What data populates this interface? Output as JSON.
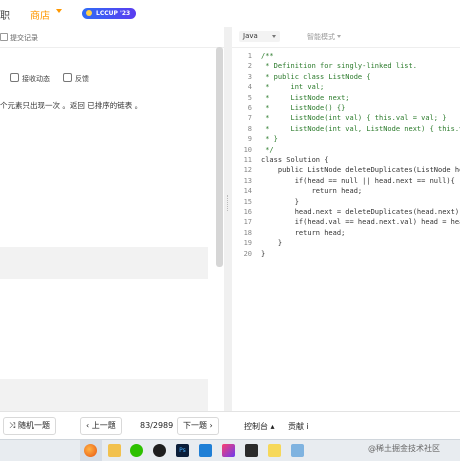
{
  "header": {
    "nav_job": "职",
    "nav_shop": "商店",
    "badge": "LCCUP '23"
  },
  "left": {
    "tab_submissions": "提交记录",
    "actions": {
      "receive": "接收动态",
      "feedback": "反馈"
    },
    "problem_text": "个元素只出现一次 。返回 已排序的链表 。"
  },
  "editor": {
    "language": "Java",
    "mode": "智能模式",
    "lines": [
      {
        "n": "1",
        "t": "/**",
        "c": true
      },
      {
        "n": "2",
        "t": " * Definition for singly-linked list.",
        "c": true
      },
      {
        "n": "3",
        "t": " * public class ListNode {",
        "c": true
      },
      {
        "n": "4",
        "t": " *     int val;",
        "c": true
      },
      {
        "n": "5",
        "t": " *     ListNode next;",
        "c": true
      },
      {
        "n": "6",
        "t": " *     ListNode() {}",
        "c": true
      },
      {
        "n": "7",
        "t": " *     ListNode(int val) { this.val = val; }",
        "c": true
      },
      {
        "n": "8",
        "t": " *     ListNode(int val, ListNode next) { this.val",
        "c": true
      },
      {
        "n": "9",
        "t": " * }",
        "c": true
      },
      {
        "n": "10",
        "t": " */",
        "c": true
      },
      {
        "n": "11",
        "t": "class Solution {",
        "c": false
      },
      {
        "n": "12",
        "t": "    public ListNode deleteDuplicates(ListNode hea",
        "c": false
      },
      {
        "n": "13",
        "t": "        if(head == null || head.next == null){",
        "c": false
      },
      {
        "n": "14",
        "t": "            return head;",
        "c": false
      },
      {
        "n": "15",
        "t": "        }",
        "c": false
      },
      {
        "n": "16",
        "t": "        head.next = deleteDuplicates(head.next);",
        "c": false
      },
      {
        "n": "17",
        "t": "        if(head.val == head.next.val) head = head",
        "c": false
      },
      {
        "n": "18",
        "t": "        return head;",
        "c": false
      },
      {
        "n": "19",
        "t": "    }",
        "c": false
      },
      {
        "n": "20",
        "t": "}",
        "c": false
      }
    ]
  },
  "bottom": {
    "random": "随机一题",
    "prev": "上一题",
    "page": "83/2989",
    "next": "下一题",
    "console": "控制台",
    "contribute": "贡献 i"
  },
  "taskbar": {
    "watermark": "@稀土掘金技术社区",
    "icons": [
      "firefox-icon",
      "file-explorer-icon",
      "wechat-icon",
      "qq-icon",
      "photoshop-icon",
      "vscode-icon",
      "intellij-icon",
      "terminal-icon",
      "notes-icon",
      "gallery-icon"
    ]
  },
  "colors": {
    "accent_orange": "#ff9800",
    "comment_green": "#2a7a2a",
    "badge_blue": "#2f6df6"
  }
}
